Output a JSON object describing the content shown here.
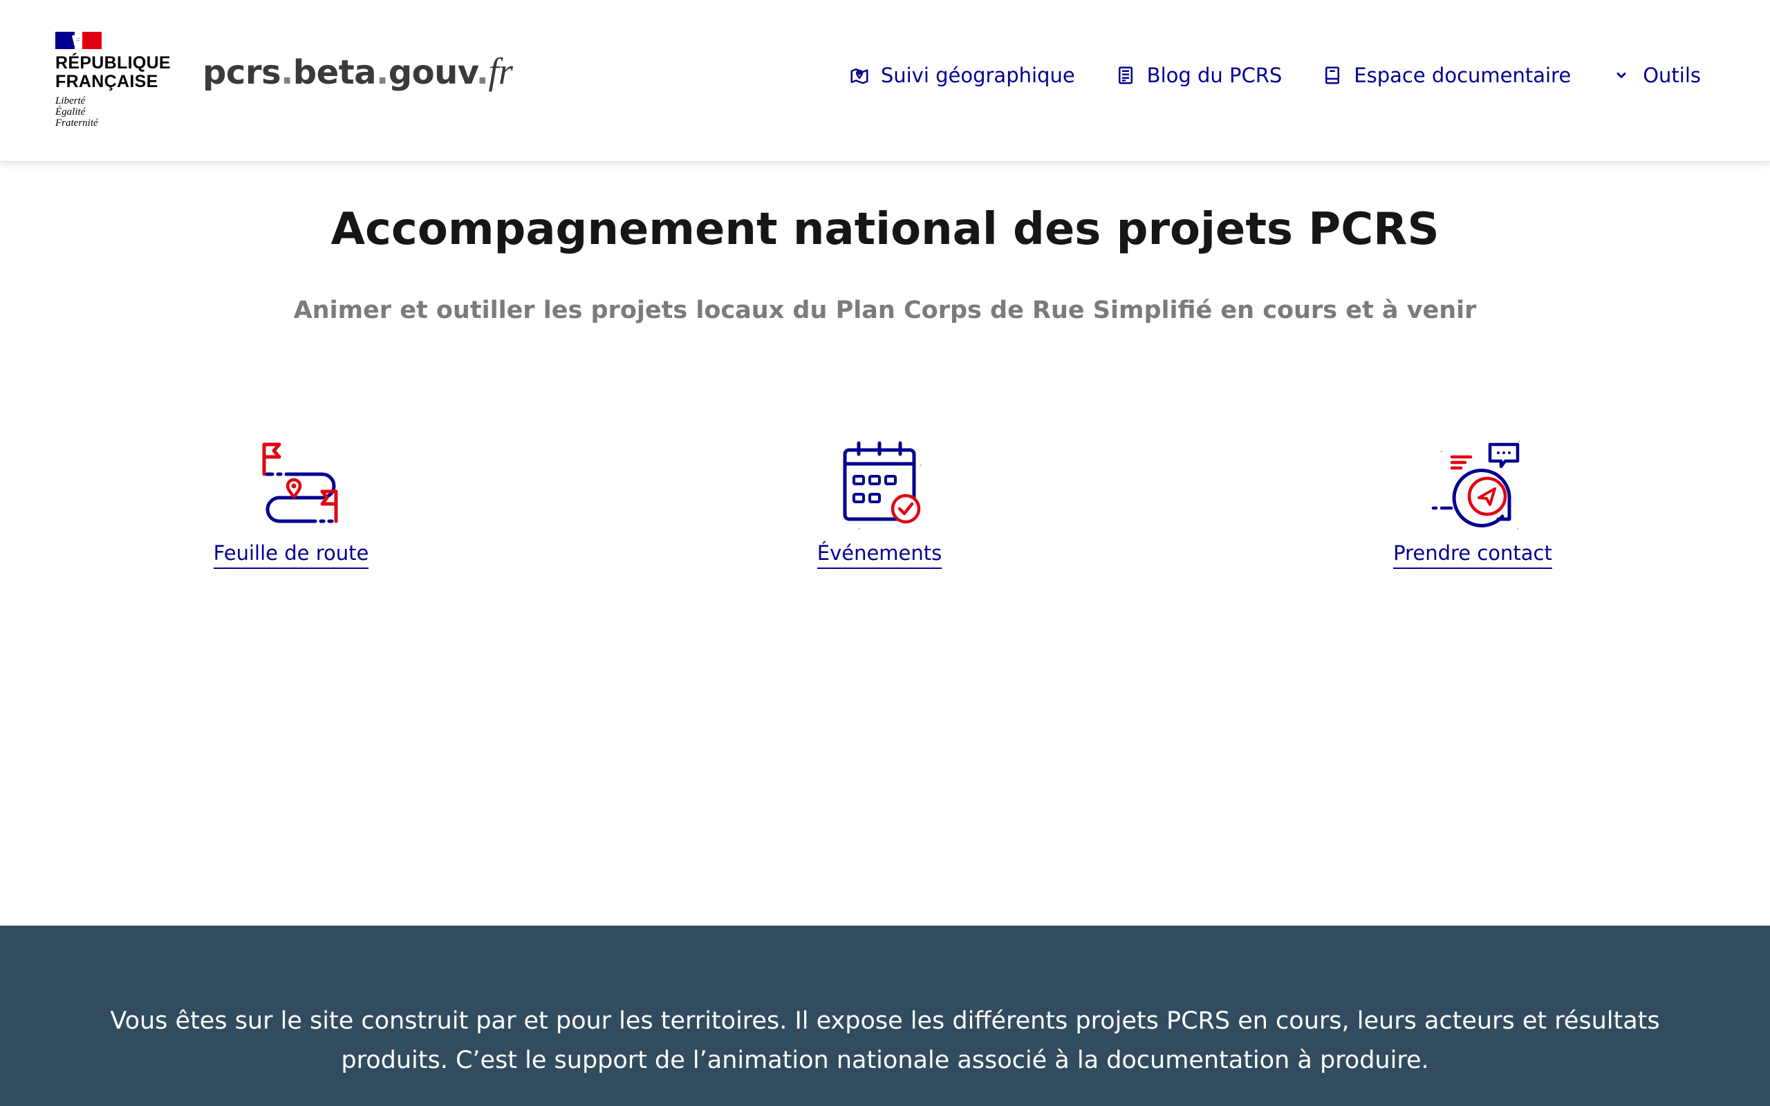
{
  "brand": {
    "republique_line1": "RÉPUBLIQUE",
    "republique_line2": "FRANÇAISE",
    "motto_line1": "Liberté",
    "motto_line2": "Égalité",
    "motto_line3": "Fraternité",
    "site_name_part1": "pcrs",
    "site_name_part2": ".",
    "site_name_part3": "beta",
    "site_name_part4": ".",
    "site_name_part5": "gouv",
    "site_name_part6": ".",
    "site_name_part7": "fr"
  },
  "nav": {
    "items": [
      {
        "label": "Suivi géographique",
        "icon": "map-pin-icon"
      },
      {
        "label": "Blog du PCRS",
        "icon": "article-icon"
      },
      {
        "label": "Espace documentaire",
        "icon": "book-icon"
      },
      {
        "label": "Outils",
        "icon": "chevron-down-icon"
      }
    ]
  },
  "main": {
    "title": "Accompagnement national des projets PCRS",
    "subtitle": "Animer et outiller les projets locaux du Plan Corps de Rue Simplifié en cours et à venir",
    "tiles": [
      {
        "label": "Feuille de route",
        "icon": "roadmap-icon"
      },
      {
        "label": "Événements",
        "icon": "calendar-icon"
      },
      {
        "label": "Prendre contact",
        "icon": "contact-icon"
      }
    ]
  },
  "footer": {
    "text": "Vous êtes sur le site construit par et pour les territoires. Il expose les différents projets PCRS en cours, leurs acteurs et résultats produits. C’est le support de l’animation nationale associé à la documentation à produire."
  },
  "colors": {
    "blue_france": "#000091",
    "red_marianne": "#e1000f",
    "footer_bg": "#324c5f",
    "subtitle_grey": "#7b7b7b"
  }
}
